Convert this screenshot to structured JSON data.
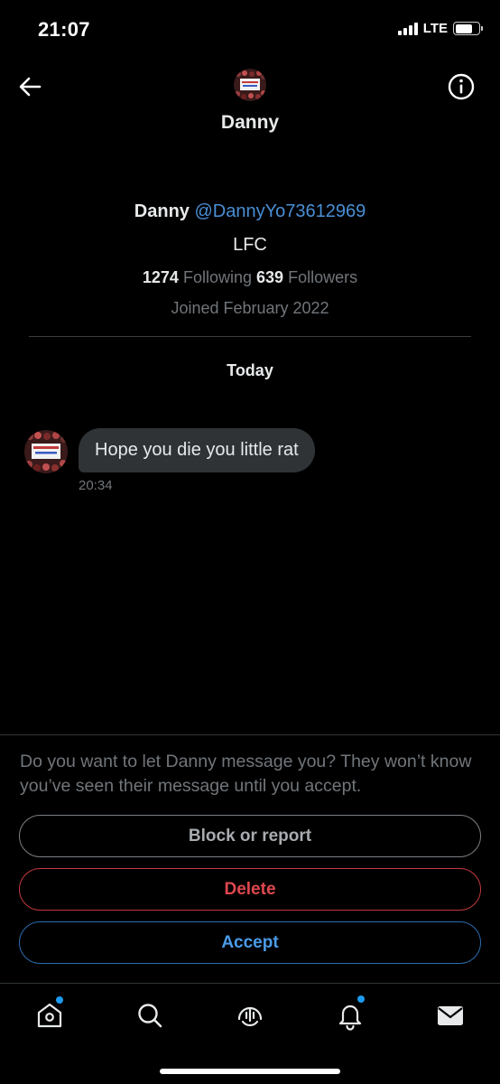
{
  "status_bar": {
    "time": "21:07",
    "network": "LTE"
  },
  "header": {
    "title": "Danny",
    "back_icon": "back-arrow-icon",
    "info_icon": "info-icon"
  },
  "profile": {
    "name": "Danny",
    "handle": "@DannyYo73612969",
    "bio": "LFC",
    "following_count": "1274",
    "following_label": "Following",
    "followers_count": "639",
    "followers_label": "Followers",
    "joined": "Joined February 2022"
  },
  "conversation": {
    "day_label": "Today",
    "messages": [
      {
        "text": "Hope you die you little rat",
        "time": "20:34"
      }
    ]
  },
  "request": {
    "prompt": "Do you want to let Danny message you? They won’t know you’ve seen their message until you accept.",
    "block_label": "Block or report",
    "delete_label": "Delete",
    "accept_label": "Accept"
  },
  "bottom_nav": {
    "items": [
      "home-icon",
      "search-icon",
      "spaces-icon",
      "notifications-icon",
      "messages-icon"
    ]
  },
  "colors": {
    "background": "#000000",
    "link": "#4a8fd6",
    "bubble": "#2f3336",
    "delete": "#e0474e",
    "accept": "#4a9be8",
    "notification_dot": "#1d9bf0"
  }
}
